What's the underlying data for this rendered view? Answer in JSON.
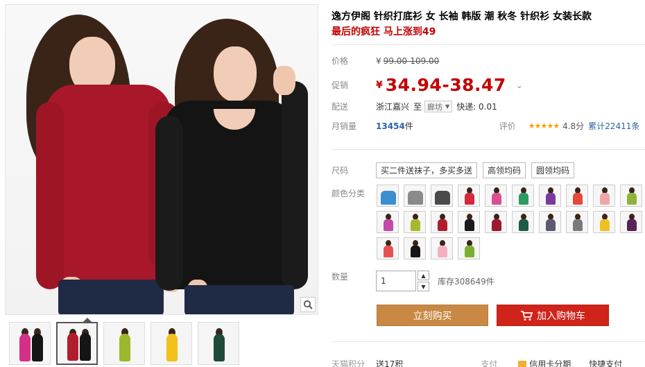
{
  "title": "逸方伊阁 针织打底衫 女 长袖 韩版 潮 秋冬 针织衫 女装长款",
  "promo": "最后的疯狂 马上涨到49",
  "price": {
    "label": "价格",
    "currency": "¥",
    "original": "99.00-109.00"
  },
  "promo_price": {
    "label": "促销",
    "currency": "¥",
    "value": "34.94-38.47",
    "chevron_icon": "chevron-down-icon"
  },
  "shipping": {
    "label": "配送",
    "from": "浙江嘉兴",
    "to_label": "至",
    "to_city": "廊坊",
    "fee": "快递: 0.01"
  },
  "sales": {
    "label": "月销量",
    "count": "13454",
    "unit": "件",
    "rating_label": "评价",
    "stars": "★★★★★",
    "score": "4.8分",
    "total_reviews": "累计22411条"
  },
  "size": {
    "label": "尺码",
    "options": [
      "买二件送袜子，多买多送",
      "高领均码",
      "圆领均码"
    ]
  },
  "color": {
    "label": "颜色分类",
    "swatches": [
      "#3b8fd0",
      "#8a8a8a",
      "#4a4a4a",
      "#d4283c",
      "#d94f8f",
      "#2e9a60",
      "#7a3aa0",
      "#e24a3a",
      "#f0a6a6",
      "#8fb33a",
      "#c24aa8",
      "#a8b82e",
      "#b01e2e",
      "#1a1a1a",
      "#9e1830",
      "#1e5a48",
      "#5a5a70",
      "#7a7a7a",
      "#f0c020",
      "#5a2058",
      "#e85050",
      "#151515",
      "#f4b0c0",
      "#7ab030"
    ]
  },
  "quantity": {
    "label": "数量",
    "value": "1",
    "stock": "库存308649件"
  },
  "buttons": {
    "buy_now": "立刻购买",
    "add_cart": "加入购物车",
    "cart_icon": "cart-icon"
  },
  "footer": {
    "points_label": "天猫积分",
    "points_value": "送17积",
    "pay_label": "支付",
    "credit": "信用卡分期",
    "fast_pay": "快捷支付"
  },
  "gallery": {
    "zoom_icon": "magnifier-icon",
    "thumbnails": [
      {
        "colors": [
          "#d4308a",
          "#151515"
        ]
      },
      {
        "colors": [
          "#b01e2e",
          "#151515"
        ]
      },
      {
        "colors": [
          "#9cb82a"
        ]
      },
      {
        "colors": [
          "#f2c21a"
        ]
      },
      {
        "colors": [
          "#1e4a3a"
        ]
      }
    ]
  }
}
